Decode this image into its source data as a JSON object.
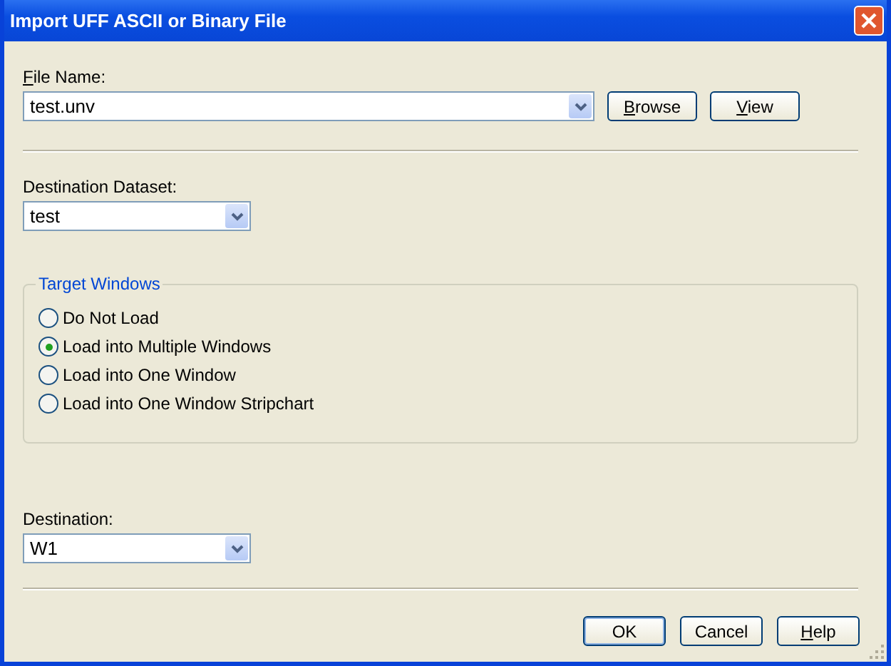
{
  "window": {
    "title": "Import UFF ASCII or Binary File"
  },
  "file_name": {
    "label": "File Name:",
    "label_underline_first": true,
    "value": "test.unv"
  },
  "file_buttons": [
    {
      "label": "Browse",
      "underline_first": true
    },
    {
      "label": "View",
      "underline_first": true
    }
  ],
  "destination_dataset": {
    "label": "Destination Dataset:",
    "value": "test"
  },
  "target_windows": {
    "title": "Target Windows",
    "options": [
      {
        "label": "Do Not Load",
        "selected": false
      },
      {
        "label": "Load into Multiple Windows",
        "selected": true
      },
      {
        "label": "Load into One Window",
        "selected": false
      },
      {
        "label": "Load into One Window Stripchart",
        "selected": false
      }
    ]
  },
  "destination": {
    "label": "Destination:",
    "value": "W1"
  },
  "buttons": [
    {
      "label": "OK",
      "underline_first": false,
      "default": true
    },
    {
      "label": "Cancel",
      "underline_first": false,
      "default": false
    },
    {
      "label": "Help",
      "underline_first": true,
      "default": false
    }
  ]
}
